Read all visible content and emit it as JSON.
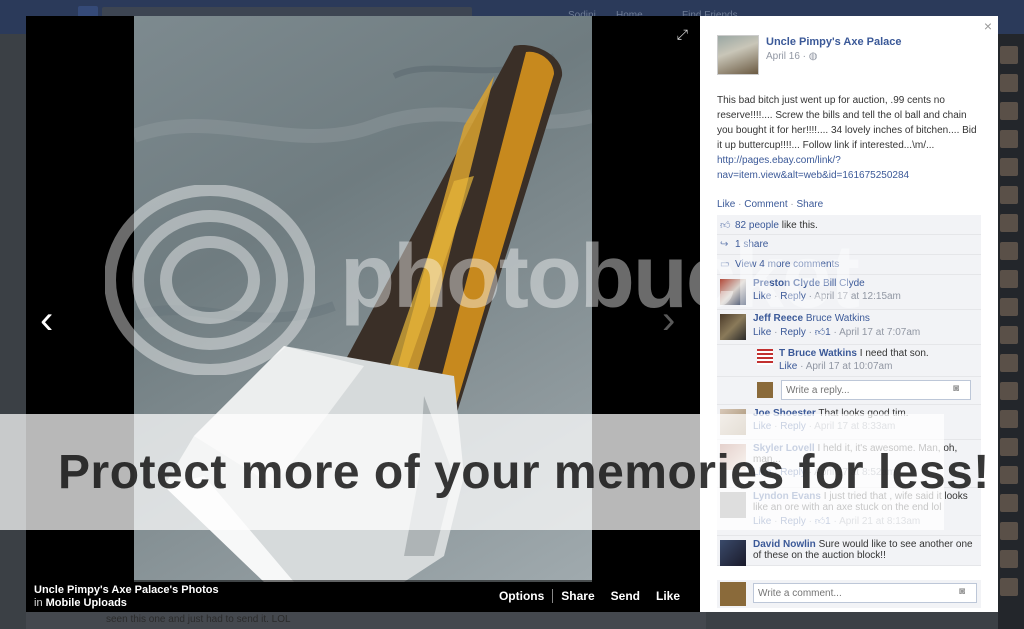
{
  "background": {
    "nav_items": [
      "Sodini",
      "Home",
      "Find Friends"
    ],
    "bottom_text": "seen this one and just had to send it. LOL"
  },
  "photo_viewer": {
    "album_title": "Uncle Pimpy's Axe Palace's Photos",
    "album_in": "in",
    "album_name": "Mobile Uploads",
    "actions": [
      "Options",
      "Share",
      "Send",
      "Like"
    ],
    "prev_label": "‹",
    "next_label": "›",
    "expand_icon": "expand-icon"
  },
  "post": {
    "page_name": "Uncle Pimpy's Axe Palace",
    "date": "April 16 · ",
    "text": "This bad bitch just went up for auction, .99 cents no reserve!!!!.... Screw the bills and tell the ol ball and chain you bought it for her!!!!.... 34 lovely inches of bitchen.... Bid it up buttercup!!!!... Follow link if interested...\\m/... ",
    "link": "http://pages.ebay.com/link/?nav=item.view&alt=web&id=161675250284",
    "actions": {
      "like": "Like",
      "comment": "Comment",
      "share": "Share",
      "sep": " · "
    }
  },
  "ufi": {
    "likes_link": "82 people",
    "likes_suffix": " like this.",
    "shares": "1 share",
    "more_comments": "View 4 more comments"
  },
  "comments": [
    {
      "name": "Preston Clyde",
      "text": "Bill Clyde",
      "like": "Like",
      "reply": "Reply",
      "likes": "",
      "time": "April 17 at 12:15am"
    },
    {
      "name": "Jeff Reece",
      "text": "Bruce Watkins",
      "like": "Like",
      "reply": "Reply",
      "likes": "1",
      "time": "April 17 at 7:07am"
    },
    {
      "name": "T Bruce Watkins",
      "text": "I need that son.",
      "like": "Like",
      "reply": "",
      "likes": "",
      "time": "April 17 at 10:07am"
    },
    {
      "name": "Joe Shoester",
      "text": "That looks good tim.",
      "like": "Like",
      "reply": "Reply",
      "likes": "",
      "time": "April 17 at 8:33am"
    },
    {
      "name": "Skyler Lovell",
      "text": "I held it, it's awesome. Man, oh, man...",
      "like": "Like",
      "reply": "Reply",
      "likes": "",
      "time": "April 17 at 8:52am"
    },
    {
      "name": "Lyndon Evans",
      "text": "I just tried that , wife said it looks like an ore with an axe stuck on the end lol",
      "like": "Like",
      "reply": "Reply",
      "likes": "1",
      "time": "April 21 at 8:13am"
    },
    {
      "name": "David Nowlin",
      "text": "Sure would like to see another one of these on the auction block!!",
      "like": "",
      "reply": "",
      "likes": "",
      "time": ""
    }
  ],
  "reply_box": {
    "placeholder": "Write a reply..."
  },
  "comment_box": {
    "placeholder": "Write a comment..."
  },
  "watermark": {
    "brand": "photobucket",
    "tagline": "Protect more of your memories for less!"
  },
  "colors": {
    "link": "#3b5998",
    "meta": "#9197a3",
    "ufi_bg": "#f2f3f6"
  }
}
